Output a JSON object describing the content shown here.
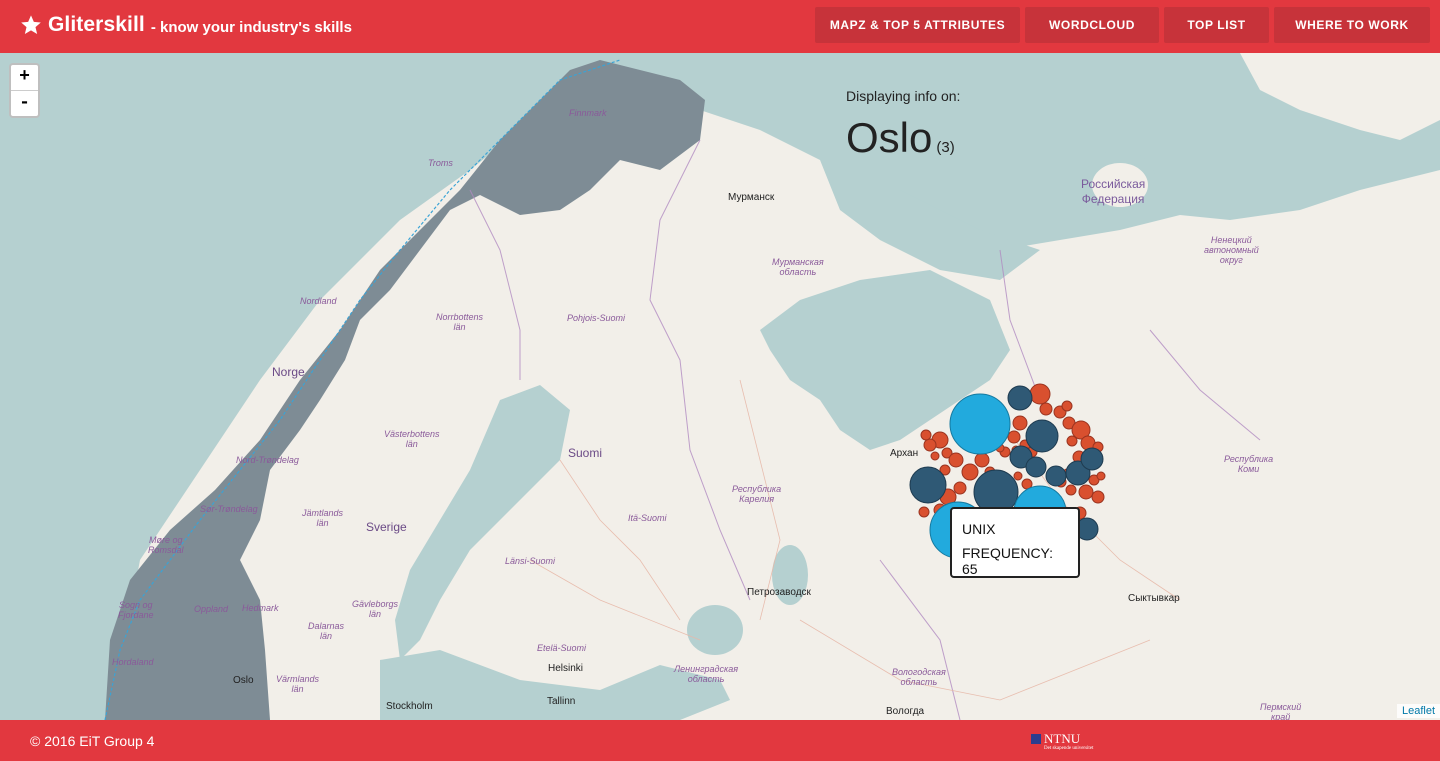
{
  "header": {
    "brand_name": "Gliterskill",
    "tagline": "- know your industry's skills",
    "nav": [
      {
        "label": "MAPZ & TOP 5 ATTRIBUTES"
      },
      {
        "label": "WORDCLOUD"
      },
      {
        "label": "TOP LIST"
      },
      {
        "label": "WHERE TO WORK"
      }
    ]
  },
  "map": {
    "zoom_in": "+",
    "zoom_out": "-",
    "labels": {
      "murmansk": "Мурманск",
      "murmansk_region": "Мурманская\nобласть",
      "russia_1": "Российская",
      "russia_2": "Федерация",
      "nenets": "Ненецкий\nавтономный\nокруг",
      "finnmark": "Finnmark",
      "nordland": "Nordland",
      "norrbotten": "Norrbottens\nlän",
      "pohjois_suomi": "Pohjois-Suomi",
      "troms": "Troms",
      "norge": "Norge",
      "vasterbotten": "Västerbottens\nlän",
      "suomi": "Suomi",
      "karelia": "Республика\nКарелия",
      "arkhangelsk": "Архан",
      "komi": "Республика\nКоми",
      "nord_trondelag": "Nord-Trøndelag",
      "jamtland": "Jämtlands\nlän",
      "sverige": "Sverige",
      "ita_suomi": "Itä-Suomi",
      "sor_trondelag": "Sør-Trøndelag",
      "more_romsdal": "Møre og\nRomsdal",
      "lansi_suomi": "Länsi-Suomi",
      "petrozavodsk": "Петрозаводск",
      "syktyvkar": "Сыктывкар",
      "sogn": "Sogn og\nFjordane",
      "oppland": "Oppland",
      "hedmark": "Hedmark",
      "gavleborg": "Gävleborgs\nlän",
      "dalarna": "Dalarnas\nlän",
      "etela_suomi": "Etelä-Suomi",
      "hordaland": "Hordaland",
      "helsinki": "Helsinki",
      "leningrad": "Ленинградская\nобласть",
      "vologda_region": "Вологодская\nобласть",
      "oslo": "Oslo",
      "varmland": "Värmlands\nlän",
      "stockholm": "Stockholm",
      "tallinn": "Tallinn",
      "vologda": "Вологда",
      "perm": "Пермский\nкрай"
    },
    "attribution": "Leaflet"
  },
  "info": {
    "lead": "Displaying info on:",
    "city": "Oslo",
    "count": "(3)"
  },
  "bubbles": {
    "colors": {
      "orange": "#d9502f",
      "navy": "#2f5975",
      "cyan": "#22aadd"
    }
  },
  "tooltip": {
    "skill": "UNIX",
    "frequency": "FREQUENCY: 65"
  },
  "footer": {
    "copyright": "© 2016 EiT Group 4",
    "ntnu": "NTNU",
    "ntnu_sub": "Det skapende universitet"
  }
}
